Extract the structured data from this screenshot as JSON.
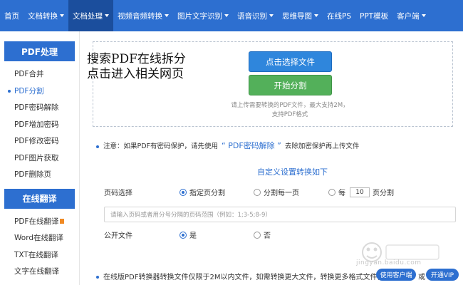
{
  "nav": {
    "items": [
      {
        "label": "首页",
        "caret": false,
        "active": false
      },
      {
        "label": "文档转换",
        "caret": true,
        "active": false
      },
      {
        "label": "文档处理",
        "caret": true,
        "active": true
      },
      {
        "label": "视频音频转换",
        "caret": true,
        "active": false
      },
      {
        "label": "图片文字识别",
        "caret": true,
        "active": false
      },
      {
        "label": "语音识别",
        "caret": true,
        "active": false
      },
      {
        "label": "思维导图",
        "caret": true,
        "active": false
      },
      {
        "label": "在线PS",
        "caret": false,
        "active": false
      },
      {
        "label": "PPT模板",
        "caret": false,
        "active": false
      },
      {
        "label": "客户端",
        "caret": true,
        "active": false
      }
    ]
  },
  "sidebar": {
    "pdf_heading": "PDF处理",
    "pdf_items": [
      "PDF合并",
      "PDF分割",
      "PDF密码解除",
      "PDF增加密码",
      "PDF修改密码",
      "PDF图片获取",
      "PDF删除页"
    ],
    "active_item": "PDF分割",
    "translate_heading": "在线翻译",
    "translate_items": [
      "PDF在线翻译",
      "Word在线翻译",
      "TXT在线翻译",
      "文字在线翻译"
    ]
  },
  "overlay": {
    "line1": "搜索PDF在线拆分",
    "line2": "点击进入相关网页"
  },
  "upload": {
    "select_button": "点击选择文件",
    "split_button": "开始分割",
    "hint_line1": "请上传需要转换的PDF文件，最大支持2M，",
    "hint_line2": "支持PDF格式"
  },
  "notice": {
    "prefix": "注意：如果PDF有密码保护，请先使用",
    "link": "“ PDF密码解除 ”",
    "suffix": "去除加密保护再上传文件"
  },
  "settings": {
    "title": "自定义设置转换如下",
    "page_select_label": "页码选择",
    "option_specified": "指定页分割",
    "option_each": "分割每一页",
    "option_every_prefix": "每",
    "option_every_value": "10",
    "option_every_suffix": "页分割",
    "range_placeholder": "请输入页码或者用分号分隔的页码范围（例如：1;3-5;8-9）",
    "public_label": "公开文件",
    "public_yes": "是",
    "public_no": "否"
  },
  "footer": {
    "text": "在线版PDF转换器转换文件仅限于2M以内文件，如需转换更大文件，转换更多格式文件，请",
    "client_button": "使用客户端",
    "or": "或",
    "vip_button": "开通VIP"
  },
  "watermark": {
    "text": "jingyan.baidu.com"
  }
}
